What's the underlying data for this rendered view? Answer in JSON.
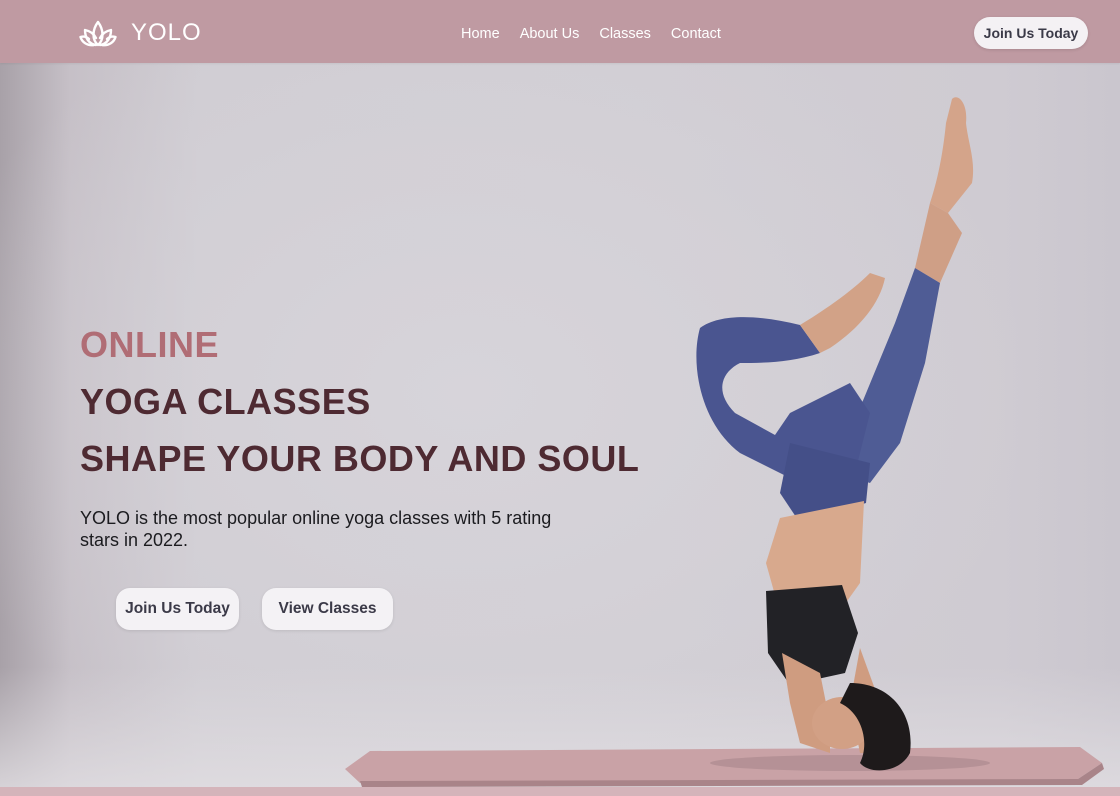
{
  "brand": {
    "name": "YOLO",
    "logo_icon": "lotus-icon"
  },
  "nav": {
    "links": [
      {
        "label": "Home"
      },
      {
        "label": "About Us"
      },
      {
        "label": "Classes"
      },
      {
        "label": "Contact"
      }
    ],
    "cta_label": "Join Us Today"
  },
  "hero": {
    "eyebrow": "ONLINE",
    "title": "YOGA CLASSES",
    "subtitle": "SHAPE YOUR BODY AND SOUL",
    "description": "YOLO is the most popular online yoga classes with 5 rating stars in 2022.",
    "buttons": {
      "primary": "Join Us Today",
      "secondary": "View Classes"
    }
  },
  "colors": {
    "navbar": "#bf9aa2",
    "accent_text": "#b06d75",
    "heading_text": "#4e2a32",
    "button_bg": "#f4f2f5",
    "button_text": "#3b3a48"
  }
}
